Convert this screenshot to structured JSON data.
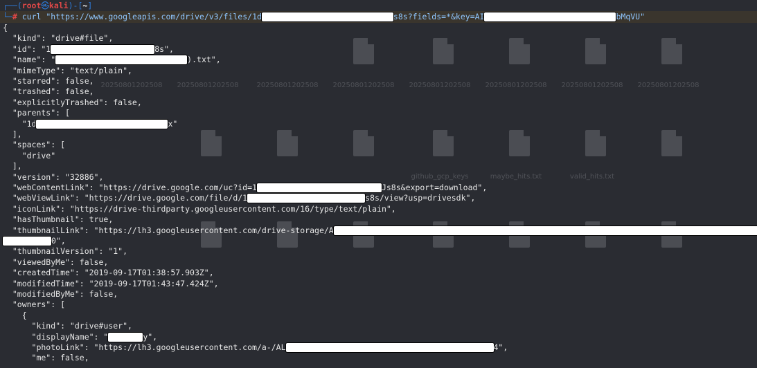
{
  "prompt": {
    "user": "root",
    "host": "kali",
    "cwd": "~",
    "symbol": "#",
    "command": "curl \"https://www.googleapis.com/drive/v3/files/1d",
    "command_end": "s8s?fields=*&key=AI",
    "command_tail": "bMqVU\""
  },
  "output_lines": [
    "{",
    "  \"kind\": \"drive#file\",",
    "  \"id\": \"1",
    "  \"name\": \"",
    "  \"mimeType\": \"text/plain\",",
    "  \"starred\": false,",
    "  \"trashed\": false,",
    "  \"explicitlyTrashed\": false,",
    "  \"parents\": [",
    "    \"1d",
    "  ],",
    "  \"spaces\": [",
    "    \"drive\"",
    "  ],",
    "  \"version\": \"32886\",",
    "  \"webContentLink\": \"https://drive.google.com/uc?id=1",
    "  \"webViewLink\": \"https://drive.google.com/file/d/1",
    "  \"iconLink\": \"https://drive-thirdparty.googleusercontent.com/16/type/text/plain\",",
    "  \"hasThumbnail\": true,",
    "  \"thumbnailLink\": \"https://lh3.googleusercontent.com/drive-storage/A",
    "0\",",
    "  \"thumbnailVersion\": \"1\",",
    "  \"viewedByMe\": false,",
    "  \"createdTime\": \"2019-09-17T01:38:57.903Z\",",
    "  \"modifiedTime\": \"2019-09-17T01:43:47.424Z\",",
    "  \"modifiedByMe\": false,",
    "  \"owners\": [",
    "    {",
    "      \"kind\": \"drive#user\",",
    "      \"displayName\": \"",
    "      \"photoLink\": \"https://lh3.googleusercontent.com/a-/AL",
    "      \"me\": false,"
  ],
  "line_suffixes": {
    "id": "8s\",",
    "name": ").txt\",",
    "parents": "x\"",
    "webContentLink": "Js8s&export=download\",",
    "webViewLink": "s8s/view?usp=drivesdk\",",
    "thumbnailLink": "",
    "displayName": "y\",",
    "photoLink": "4\","
  },
  "desktop_labels": [
    "20250801202508",
    "20250801202508",
    "20250801202508",
    "20250801202508",
    "20250801202508",
    "20250801202508",
    "20250801202508",
    "20250801202508",
    "20250801202508",
    "maybe_hits.txt",
    "valid_hits.txt",
    "leaked_gcp_keys.txt",
    "github_gcp_keys"
  ],
  "colors": {
    "background": "#2a2c32",
    "prompt_blue": "#2f7bd9",
    "root_red": "#e04848",
    "text": "#e6e6e6"
  }
}
